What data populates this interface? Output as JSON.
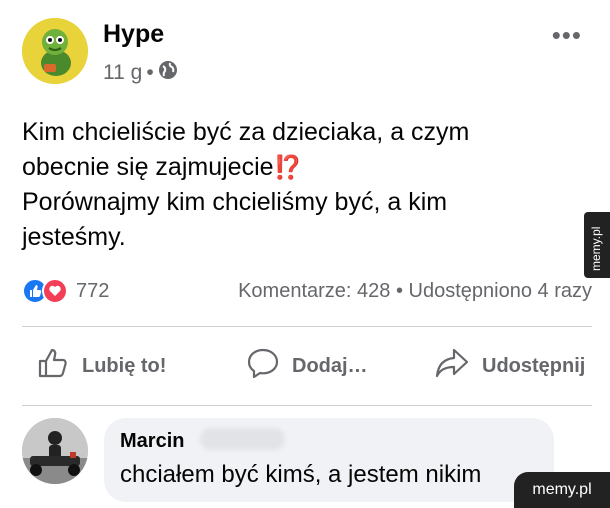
{
  "post": {
    "author": "Hype",
    "time": "11 g",
    "separator": "•",
    "text_line1": "Kim chcieliście być za dzieciaka, a czym",
    "text_line2": "obecnie się zajmujecie",
    "text_emoji": "⁉️",
    "text_line3": "Porównajmy kim chcieliśmy być, a kim",
    "text_line4": "jesteśmy."
  },
  "stats": {
    "reactions_count": "772",
    "comments": "Komentarze: 428",
    "dot": "•",
    "shares": "Udostępniono 4 razy"
  },
  "actions": {
    "like": "Lubię to!",
    "comment": "Dodaj…",
    "share": "Udostępnij"
  },
  "comment": {
    "name": "Marcin",
    "text": "chciałem być kimś, a jestem nikim"
  },
  "watermarks": {
    "side": "memy.pl",
    "bottom": "memy.pl"
  },
  "colors": {
    "like_blue": "#1877f2",
    "love_red": "#f33e58",
    "muted": "#65676b"
  }
}
